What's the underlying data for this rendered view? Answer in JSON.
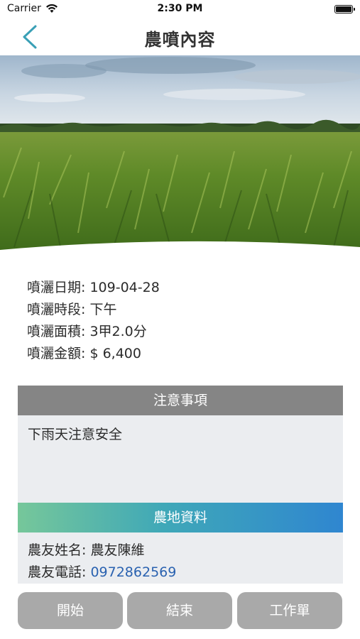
{
  "status_bar": {
    "carrier": "Carrier",
    "time": "2:30 PM"
  },
  "nav": {
    "title": "農噴內容",
    "back_icon": "chevron-left-icon"
  },
  "info": {
    "date_label": "噴灑日期:",
    "date_value": "109-04-28",
    "period_label": "噴灑時段:",
    "period_value": "下午",
    "area_label": "噴灑面積:",
    "area_value": "3甲2.0分",
    "amount_label": "噴灑金額:",
    "amount_value": "$ 6,400"
  },
  "notice": {
    "header": "注意事項",
    "content": "下雨天注意安全"
  },
  "farm": {
    "header": "農地資料",
    "name_label": "農友姓名:",
    "name_value": "農友陳維",
    "phone_label": "農友電話:",
    "phone_value": "0972862569"
  },
  "buttons": {
    "start": "開始",
    "end": "結束",
    "work_order": "工作單"
  },
  "colors": {
    "accent": "#3fa8b8",
    "phone_link": "#2a62b0",
    "button_bg": "#a9a9a9",
    "notice_header": "#858585"
  }
}
